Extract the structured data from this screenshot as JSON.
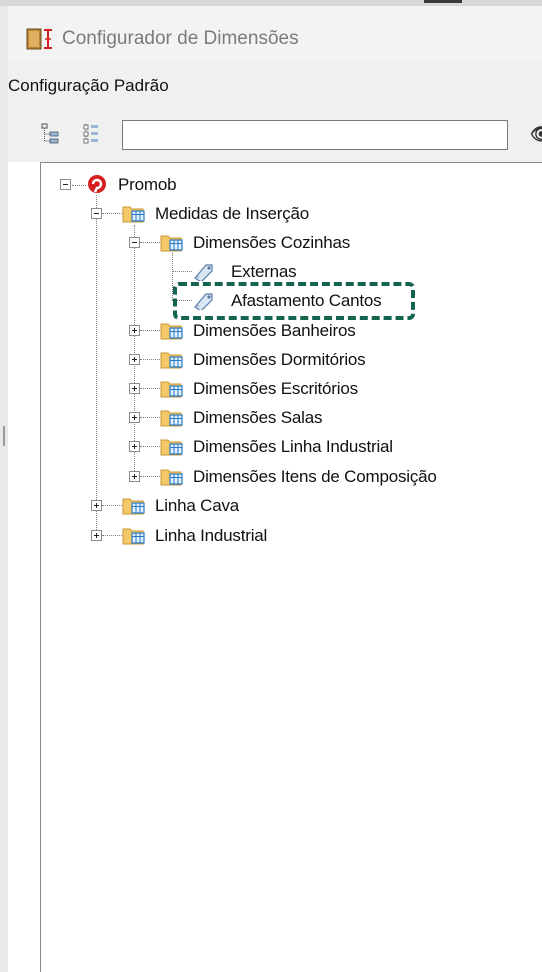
{
  "window": {
    "title": "Configurador de Dimensões",
    "icon": "ruler-app-icon"
  },
  "config": {
    "label": "Configuração Padrão"
  },
  "toolbar": {
    "search_value": "",
    "buttons": [
      "collapse-tree-icon",
      "expand-tree-icon"
    ],
    "find_icon": "binoculars-icon"
  },
  "tree": {
    "root": "Promob",
    "medidas": "Medidas de Inserção",
    "cozinhas": "Dimensões Cozinhas",
    "externas": "Externas",
    "afastamento": "Afastamento Cantos",
    "banheiros": "Dimensões Banheiros",
    "dormitorios": "Dimensões Dormitórios",
    "escritorios": "Dimensões Escritórios",
    "salas": "Dimensões Salas",
    "linha_industrial_dim": "Dimensões Linha Industrial",
    "itens_composicao": "Dimensões Itens de Composição",
    "linha_cava": "Linha Cava",
    "linha_industrial": "Linha Industrial"
  },
  "colors": {
    "highlight": "#146451",
    "folder": "#f2c869",
    "promob_red": "#d42020"
  }
}
